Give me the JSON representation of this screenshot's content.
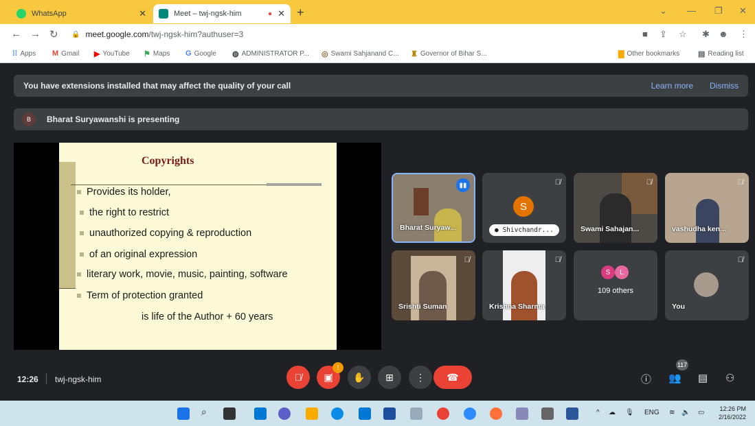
{
  "browser": {
    "tabs": [
      {
        "label": "WhatsApp",
        "active": false
      },
      {
        "label": "Meet – twj-ngsk-him",
        "active": true
      }
    ],
    "new_tab": "+",
    "url_host": "meet.google.com",
    "url_path": "/twj-ngsk-him?authuser=3",
    "bookmarks": [
      {
        "label": "Apps",
        "icon": "apps-icon"
      },
      {
        "label": "Gmail",
        "icon": "gmail-icon"
      },
      {
        "label": "YouTube",
        "icon": "youtube-icon"
      },
      {
        "label": "Maps",
        "icon": "maps-icon"
      },
      {
        "label": "Google",
        "icon": "google-icon"
      },
      {
        "label": "ADMINISTRATOR P...",
        "icon": "globe-icon"
      },
      {
        "label": "Swami Sahjanand C...",
        "icon": "site-icon"
      },
      {
        "label": "Governor of Bihar S...",
        "icon": "site-icon"
      }
    ],
    "other_bookmarks": "Other bookmarks",
    "reading_list": "Reading list"
  },
  "meet": {
    "extension_banner": {
      "message": "You have extensions installed that may affect the quality of your call",
      "learn_more": "Learn more",
      "dismiss": "Dismiss"
    },
    "presenting_banner": {
      "avatar": "B",
      "text": "Bharat Suryawanshi is presenting"
    },
    "slide": {
      "title": "Copyrights",
      "bullets": [
        "Provides its holder,",
        "the right to restrict",
        "unauthorized copying & reproduction",
        "of an original expression",
        "literary work, movie, music, painting, software",
        "Term of protection granted"
      ],
      "footer": "is life of the Author +  60 years"
    },
    "participants": [
      {
        "name": "Bharat Suryaw...",
        "speaking": true
      },
      {
        "name": "Shivchandr...",
        "avatar": "S"
      },
      {
        "name": "Swami Sahajan..."
      },
      {
        "name": "vashudha ken..."
      },
      {
        "name": "Srishti Suman"
      },
      {
        "name": "Krishna Sharma"
      },
      {
        "name": "109 others",
        "avatars": [
          "S",
          "L"
        ]
      },
      {
        "name": "You"
      }
    ],
    "toolbar": {
      "time": "12:26",
      "meeting_code": "twj-ngsk-him",
      "present_badge": "!",
      "people_count": "117"
    }
  },
  "taskbar": {
    "language": "ENG",
    "time": "12:26 PM",
    "date": "2/16/2022"
  },
  "colors": {
    "tab_strip": "#f8c93e",
    "meet_bg": "#202124",
    "end_call": "#ea4335",
    "link": "#8ab4f8"
  }
}
